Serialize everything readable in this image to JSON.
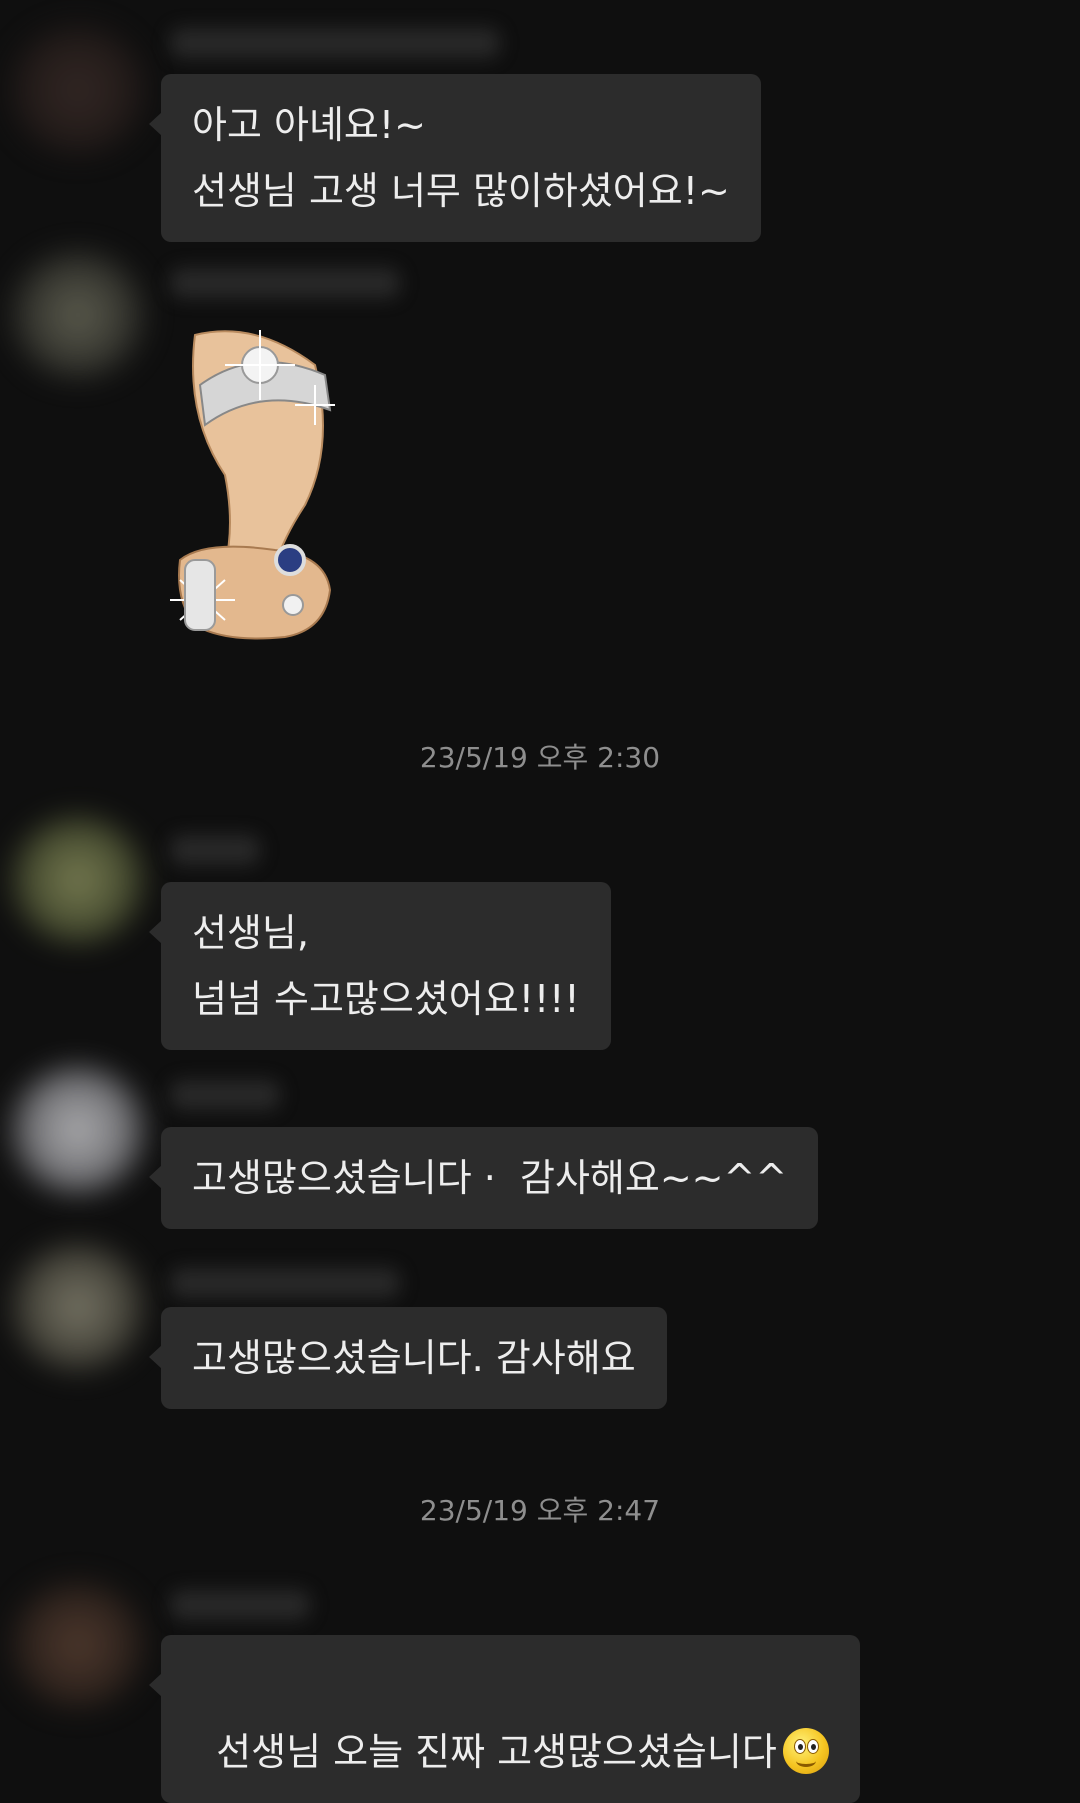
{
  "messages": [
    {
      "text": "아고 아녜요!~\n선생님 고생 너무 많이하셨어요!~"
    },
    {
      "sticker": "ring-thumbs-up-sticker"
    },
    {
      "text": "선생님,\n넘넘 수고많으셨어요!!!!"
    },
    {
      "text": "고생많으셨습니다 ·  감사해요~~^^"
    },
    {
      "text": "고생많으셨습니다. 감사해요"
    },
    {
      "text": "선생님 오늘 진짜 고생많으셨습니다",
      "emoji": "smiley-face-icon"
    }
  ],
  "timestamps": [
    "23/5/19 오후 2:30",
    "23/5/19 오후 2:47"
  ],
  "colors": {
    "background": "#0f0f0f",
    "bubble": "#2c2c2c",
    "text": "#ededed",
    "timestamp": "#8e8e8e"
  }
}
